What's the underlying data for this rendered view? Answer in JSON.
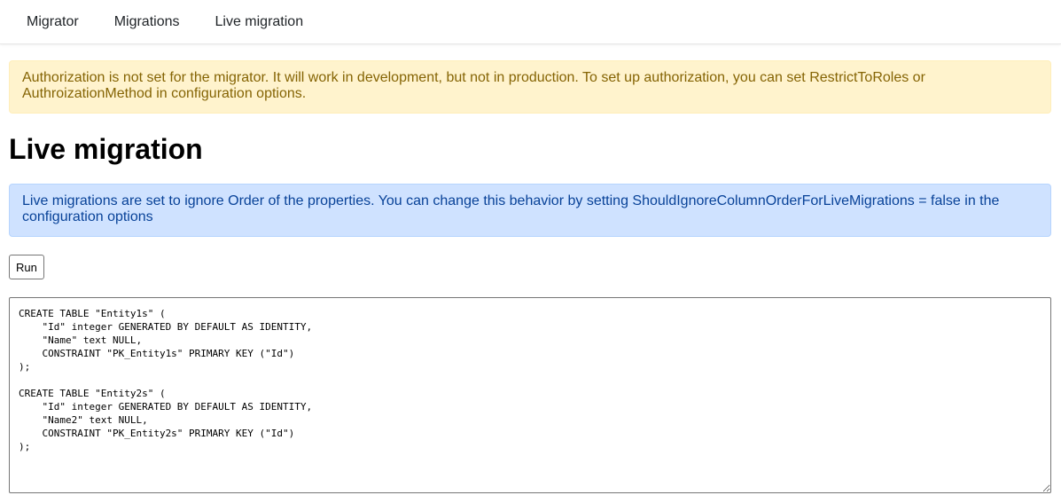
{
  "nav": {
    "items": [
      {
        "label": "Migrator"
      },
      {
        "label": "Migrations"
      },
      {
        "label": "Live migration"
      }
    ]
  },
  "alerts": {
    "warning": "Authorization is not set for the migrator. It will work in development, but not in production. To set up authorization, you can set RestrictToRoles or AuthroizationMethod in configuration options.",
    "info": "Live migrations are set to ignore Order of the properties. You can change this behavior by setting ShouldIgnoreColumnOrderForLiveMigrations = false in the configuration options"
  },
  "page": {
    "title": "Live migration",
    "run_label": "Run"
  },
  "sql_output": "CREATE TABLE \"Entity1s\" (\n    \"Id\" integer GENERATED BY DEFAULT AS IDENTITY,\n    \"Name\" text NULL,\n    CONSTRAINT \"PK_Entity1s\" PRIMARY KEY (\"Id\")\n);\n\nCREATE TABLE \"Entity2s\" (\n    \"Id\" integer GENERATED BY DEFAULT AS IDENTITY,\n    \"Name2\" text NULL,\n    CONSTRAINT \"PK_Entity2s\" PRIMARY KEY (\"Id\")\n);"
}
